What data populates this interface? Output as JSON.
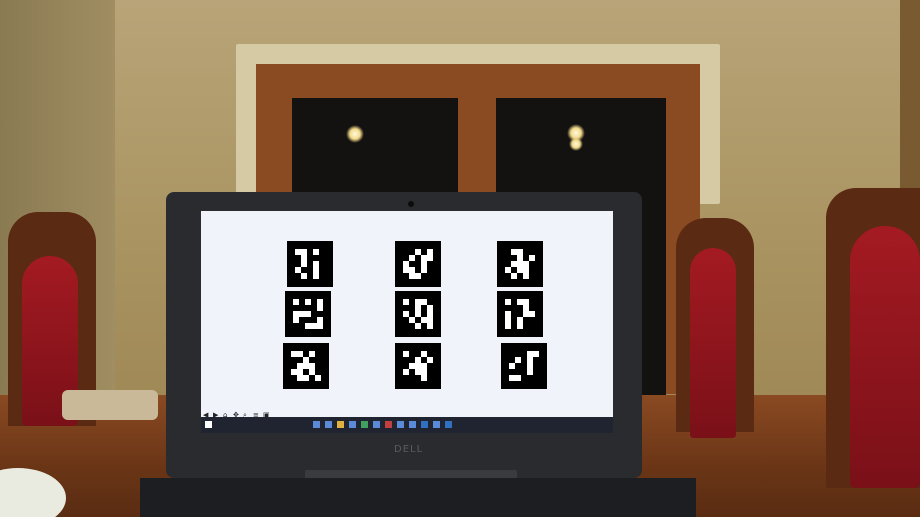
{
  "scene": {
    "description_label": "",
    "laptop_brand": "DELL"
  },
  "screen": {
    "marker_count": 9,
    "markers": [
      {
        "name": "marker-1"
      },
      {
        "name": "marker-2"
      },
      {
        "name": "marker-3"
      },
      {
        "name": "marker-4"
      },
      {
        "name": "marker-5"
      },
      {
        "name": "marker-6"
      },
      {
        "name": "marker-7"
      },
      {
        "name": "marker-8"
      },
      {
        "name": "marker-9"
      }
    ]
  },
  "colors": {
    "screen_bg": "#f0f3fa",
    "marker": "#000000",
    "chair_red": "#a41a22",
    "wood": "#8a4a22"
  }
}
